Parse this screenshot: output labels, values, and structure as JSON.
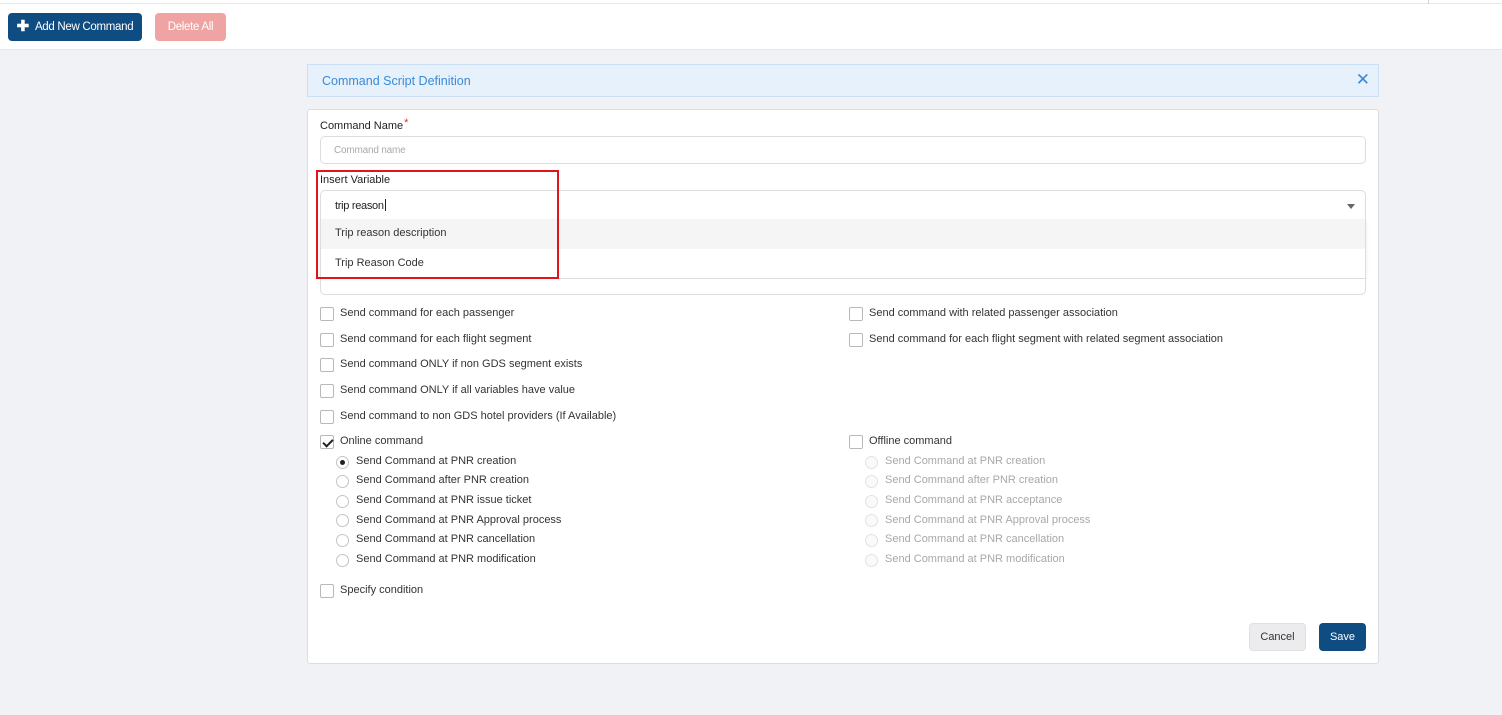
{
  "toolbar": {
    "add_label": "Add New Command",
    "add_icon": "plus-icon",
    "delete_label": "Delete All"
  },
  "panel": {
    "title": "Command Script Definition",
    "close_icon": "close-icon"
  },
  "form": {
    "command_name_label": "Command Name",
    "required_mark": "*",
    "command_name_value": "",
    "command_name_placeholder": "Command name",
    "insert_variable_label": "Insert Variable",
    "insert_variable_query": "trip reason",
    "dropdown_options": [
      "Trip reason description",
      "Trip Reason Code"
    ]
  },
  "options": {
    "left": [
      {
        "label": "Send command for each passenger",
        "checked": false
      },
      {
        "label": "Send command for each flight segment",
        "checked": false
      },
      {
        "label": "Send command ONLY if non GDS segment exists",
        "checked": false
      },
      {
        "label": "Send command ONLY if all variables have value",
        "checked": false
      },
      {
        "label": "Send command to non GDS hotel providers (If Available)",
        "checked": false
      }
    ],
    "right": [
      {
        "label": "Send command with related passenger association",
        "checked": false
      },
      {
        "label": "Send command for each flight segment with related segment association",
        "checked": false
      }
    ]
  },
  "online": {
    "label": "Online command",
    "checked": true,
    "radios": [
      {
        "label": "Send Command at PNR creation",
        "selected": true
      },
      {
        "label": "Send Command after PNR creation",
        "selected": false
      },
      {
        "label": "Send Command at PNR issue ticket",
        "selected": false
      },
      {
        "label": "Send Command at PNR Approval process",
        "selected": false
      },
      {
        "label": "Send Command at PNR cancellation",
        "selected": false
      },
      {
        "label": "Send Command at PNR modification",
        "selected": false
      }
    ]
  },
  "offline": {
    "label": "Offline command",
    "checked": false,
    "radios": [
      {
        "label": "Send Command at PNR creation",
        "selected": false
      },
      {
        "label": "Send Command after PNR creation",
        "selected": false
      },
      {
        "label": "Send Command at PNR acceptance",
        "selected": false
      },
      {
        "label": "Send Command at PNR Approval process",
        "selected": false
      },
      {
        "label": "Send Command at PNR cancellation",
        "selected": false
      },
      {
        "label": "Send Command at PNR modification",
        "selected": false
      }
    ]
  },
  "condition": {
    "label": "Specify condition",
    "checked": false
  },
  "actions": {
    "cancel_label": "Cancel",
    "save_label": "Save"
  },
  "colors": {
    "primary": "#0f4c81",
    "danger_light": "#f0a3a3",
    "header_blue": "#3a8ad6",
    "highlight_red": "#e0141a"
  }
}
